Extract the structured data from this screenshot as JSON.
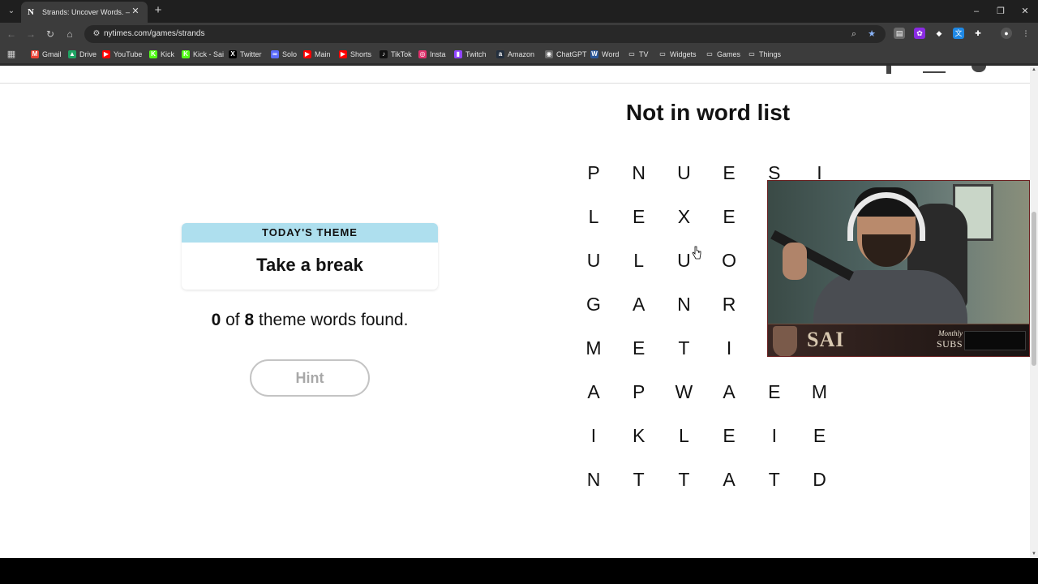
{
  "browser": {
    "tab_title": "Strands: Uncover Words. — The",
    "tab_favicon": "N",
    "url": "nytimes.com/games/strands",
    "bookmarks": [
      {
        "label": "Gmail",
        "icon": "gmail-icon",
        "color": "#ea4335"
      },
      {
        "label": "Drive",
        "icon": "drive-icon",
        "color": "#1fa463"
      },
      {
        "label": "YouTube",
        "icon": "youtube-icon",
        "color": "#ff0000"
      },
      {
        "label": "Kick",
        "icon": "kick-icon",
        "color": "#53fc18"
      },
      {
        "label": "Kick - Sai",
        "icon": "kick-icon",
        "color": "#53fc18"
      },
      {
        "label": "Twitter",
        "icon": "x-icon",
        "color": "#000000"
      },
      {
        "label": "Solo",
        "icon": "solo-icon",
        "color": "#5b6cff"
      },
      {
        "label": "Main",
        "icon": "youtube-icon",
        "color": "#ff0000"
      },
      {
        "label": "Shorts",
        "icon": "youtube-icon",
        "color": "#ff0000"
      },
      {
        "label": "TikTok",
        "icon": "tiktok-icon",
        "color": "#111111"
      },
      {
        "label": "Insta",
        "icon": "instagram-icon",
        "color": "#e1306c"
      },
      {
        "label": "Twitch",
        "icon": "twitch-icon",
        "color": "#9146ff"
      },
      {
        "label": "Amazon",
        "icon": "amazon-icon",
        "color": "#232f3e"
      },
      {
        "label": "ChatGPT",
        "icon": "chatgpt-icon",
        "color": "#6b6b6b"
      },
      {
        "label": "Word",
        "icon": "word-icon",
        "color": "#2b579a"
      },
      {
        "label": "TV",
        "icon": "folder-icon",
        "color": "#3c3c3c"
      },
      {
        "label": "Widgets",
        "icon": "folder-icon",
        "color": "#3c3c3c"
      },
      {
        "label": "Games",
        "icon": "folder-icon",
        "color": "#3c3c3c"
      },
      {
        "label": "Things",
        "icon": "folder-icon",
        "color": "#3c3c3c"
      }
    ]
  },
  "game": {
    "toast": "Not in word list",
    "theme_label": "TODAY'S THEME",
    "theme": "Take a break",
    "found_count": "0",
    "total_count": "8",
    "found_suffix": "theme words found.",
    "found_of": "of",
    "hint_label": "Hint",
    "theme_color": "#aedfee",
    "grid": [
      [
        "P",
        "N",
        "U",
        "E",
        "S",
        "I"
      ],
      [
        "L",
        "E",
        "X",
        "E",
        "",
        ""
      ],
      [
        "U",
        "L",
        "U",
        "O",
        "",
        ""
      ],
      [
        "G",
        "A",
        "N",
        "R",
        "",
        ""
      ],
      [
        "M",
        "E",
        "T",
        "I",
        "",
        ""
      ],
      [
        "A",
        "P",
        "W",
        "A",
        "E",
        "M"
      ],
      [
        "I",
        "K",
        "L",
        "E",
        "I",
        "E"
      ],
      [
        "N",
        "T",
        "T",
        "A",
        "T",
        "D"
      ]
    ]
  },
  "webcam": {
    "name": "SAI",
    "monthly": "Monthly",
    "subs": "SUBS"
  }
}
